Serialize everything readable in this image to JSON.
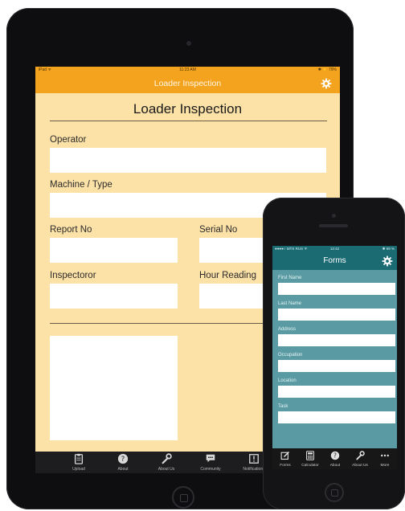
{
  "colors": {
    "ipad_accent": "#f4a31f",
    "ipad_form_bg": "#fde2a8",
    "phone_accent": "#1b6b73",
    "phone_form_bg": "#5a9aa2"
  },
  "ipad": {
    "status": {
      "carrier": "iPad ᯤ",
      "time": "11:23 AM",
      "battery": "✱ ⚡ 79%"
    },
    "nav_title": "Loader Inspection",
    "nav_icon": "gear-icon",
    "form_title": "Loader Inspection",
    "labels": {
      "operator": "Operator",
      "machine": "Machine / Type",
      "report_no": "Report No",
      "serial_no": "Serial No",
      "inspector": "Inspectoror",
      "hour_reading": "Hour Reading"
    },
    "tabs": [
      {
        "label": "Upload",
        "icon": "clipboard-icon"
      },
      {
        "label": "About",
        "icon": "help-icon"
      },
      {
        "label": "About Us",
        "icon": "wrench-icon"
      },
      {
        "label": "Community",
        "icon": "chat-icon"
      },
      {
        "label": "Notifications",
        "icon": "alert-icon"
      }
    ]
  },
  "iphone": {
    "status": {
      "carrier": "●●●●○ MTS RUS ᯤ",
      "time": "12:42",
      "battery": "✱ 69 %"
    },
    "nav_title": "Forms",
    "nav_icon": "gear-icon",
    "fields": [
      "First Name",
      "Last Name",
      "Address",
      "Occupation",
      "Location",
      "Task"
    ],
    "tabs": [
      {
        "label": "Forms",
        "icon": "edit-icon"
      },
      {
        "label": "Calculator",
        "icon": "calculator-icon"
      },
      {
        "label": "About",
        "icon": "help-icon"
      },
      {
        "label": "About Us",
        "icon": "wrench-icon"
      },
      {
        "label": "More",
        "icon": "more-icon"
      }
    ]
  }
}
